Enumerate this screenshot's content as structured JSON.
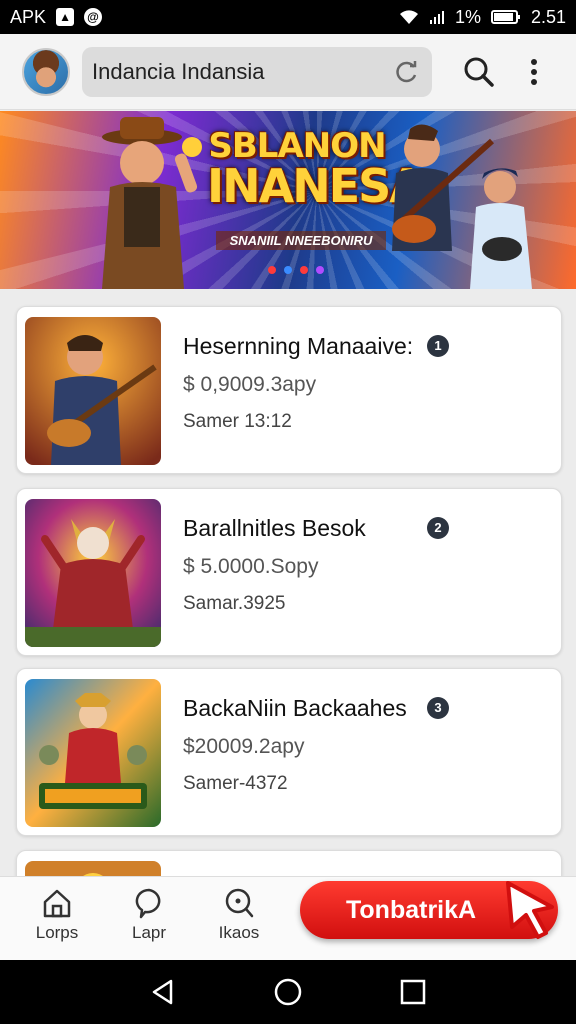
{
  "status_bar": {
    "left_label": "APK",
    "battery_percent": "1%",
    "time": "2.51"
  },
  "header": {
    "search_value": "Indancia Indansia"
  },
  "banner": {
    "title_line1": "SBLANON",
    "title_line2": "INANESA",
    "subtitle": "SNANIIL NNEEBONIRU",
    "dot_colors": [
      "#ff3b3b",
      "#3a8cff",
      "#ff3b3b",
      "#b04cff"
    ]
  },
  "list": {
    "items": [
      {
        "title": "Hesernning Manaaive:",
        "badge": "1",
        "price": "$ 0,9009.3apy",
        "subtitle": "Samer 13:12",
        "thumb": "guitar-hero"
      },
      {
        "title": "Barallnitles Besok",
        "badge": "2",
        "price": "$ 5.0000.Sopy",
        "subtitle": "Samar.3925",
        "thumb": "demon-warrior"
      },
      {
        "title": "BackaNiin Backaahes",
        "badge": "3",
        "price": "$20009.2apy",
        "subtitle": "Samer-4372",
        "thumb": "battle-crowd"
      }
    ]
  },
  "bottom_nav": {
    "items": [
      {
        "label": "Lorps",
        "icon": "home-icon"
      },
      {
        "label": "Lapr",
        "icon": "chat-icon"
      },
      {
        "label": "Ikaos",
        "icon": "search-icon"
      }
    ],
    "cta_label": "TonbatrikA"
  },
  "colors": {
    "cta_red": "#e81b1b",
    "badge_dark": "#2c3440",
    "header_bg": "#f4f4f4"
  }
}
